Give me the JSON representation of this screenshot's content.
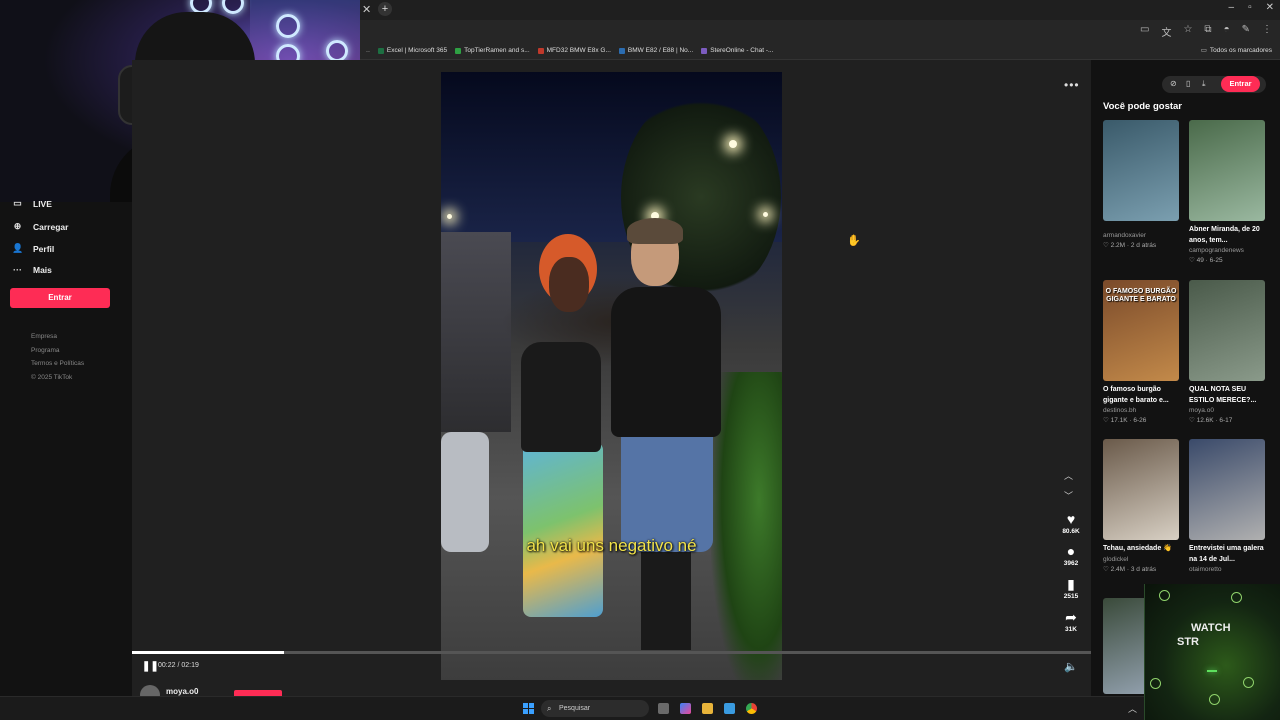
{
  "bookmarks": [
    {
      "label": "Excel | Microsoft 365",
      "color": "#1d6f42"
    },
    {
      "label": "TopTierRamen and s...",
      "color": "#2ea043"
    },
    {
      "label": "MFD32 BMW E8x G...",
      "color": "#c0392b"
    },
    {
      "label": "BMW E82 / E88 | No...",
      "color": "#2b6cb0"
    },
    {
      "label": "StereOnline - Chat -...",
      "color": "#7c5cbf"
    }
  ],
  "bookmarks_all": "Todos os marcadores",
  "leftnav": {
    "items": [
      {
        "icon": "▭",
        "label": "LIVE"
      },
      {
        "icon": "⊕",
        "label": "Carregar"
      },
      {
        "icon": "👤",
        "label": "Perfil"
      },
      {
        "icon": "···",
        "label": "Mais"
      }
    ],
    "entrar": "Entrar",
    "footer": [
      "Empresa",
      "Programa",
      "Termos e Políticas",
      "© 2025 TikTok"
    ]
  },
  "video": {
    "subtitle": "ah vai uns negativo né",
    "current_time": "00:22",
    "duration": "02:19",
    "timecode": "00:22 / 02:19",
    "progress": 0.158,
    "author": "moya.o0"
  },
  "rail": {
    "likes": "80.6K",
    "comments": "3962",
    "saves": "2515",
    "shares": "31K"
  },
  "right": {
    "entrar": "Entrar",
    "heading": "Você pode gostar",
    "cards": [
      {
        "title": "",
        "author": "armandoxavier",
        "meta": "♡ 2.2M · 2 d atrás",
        "thumb_colors": [
          "#3a5a6a",
          "#7b9fb0"
        ],
        "caption": ""
      },
      {
        "title": "Abner Miranda, de 20 anos, tem...",
        "author": "campograndenews",
        "meta": "♡ 49 · 6-25",
        "thumb_colors": [
          "#4a6a4a",
          "#9ab8a0"
        ],
        "caption": ""
      },
      {
        "title": "O famoso burgão gigante e barato e...",
        "author": "destinos.bh",
        "meta": "♡ 17.1K · 6-26",
        "thumb_colors": [
          "#7a4a2a",
          "#c38a4a"
        ],
        "caption": "O FAMOSO BURGÃO GIGANTE E BARATO"
      },
      {
        "title": "QUAL NOTA SEU ESTILO MERECE?...",
        "author": "moya.o0",
        "meta": "♡ 12.6K · 6-17",
        "thumb_colors": [
          "#4a5a4a",
          "#8a9a8a"
        ],
        "caption": ""
      },
      {
        "title": "Tchau, ansiedade 👋",
        "author": "glodickel",
        "meta": "♡ 2.4M · 3 d atrás",
        "thumb_colors": [
          "#6a5a4a",
          "#d8d0c4"
        ],
        "caption": ""
      },
      {
        "title": "Entrevistei uma galera na 14 de Jul...",
        "author": "otaimoretto",
        "meta": "",
        "thumb_colors": [
          "#3a4a6a",
          "#b0b0b0"
        ],
        "caption": ""
      },
      {
        "title": "",
        "author": "",
        "meta": "",
        "thumb_colors": [
          "#3a4a3a",
          "#9aa8b8"
        ],
        "caption": ""
      }
    ]
  },
  "overlay": {
    "line1": "WATCH",
    "line2": "STR"
  },
  "taskbar": {
    "search_placeholder": "Pesquisar"
  }
}
